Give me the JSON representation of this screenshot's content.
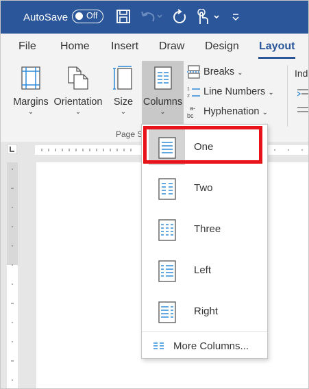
{
  "titlebar": {
    "autosave_label": "AutoSave",
    "toggle_state": "Off",
    "icons": [
      "save-icon",
      "undo-icon",
      "redo-icon",
      "touch-mode-icon",
      "customize-quick-access-icon"
    ],
    "color": "#2b579a"
  },
  "tabs": [
    {
      "label": "File",
      "active": false
    },
    {
      "label": "Home",
      "active": false
    },
    {
      "label": "Insert",
      "active": false
    },
    {
      "label": "Draw",
      "active": false
    },
    {
      "label": "Design",
      "active": false
    },
    {
      "label": "Layout",
      "active": true
    }
  ],
  "ribbon": {
    "margins": "Margins",
    "orientation": "Orientation",
    "size": "Size",
    "columns": "Columns",
    "breaks": "Breaks",
    "line_numbers": "Line Numbers",
    "hyphenation": "Hyphenation",
    "group_label": "Page S",
    "indent_label": "Ind"
  },
  "columns_menu": {
    "items": [
      {
        "label": "One",
        "selected": true
      },
      {
        "label": "Two",
        "selected": false
      },
      {
        "label": "Three",
        "selected": false
      },
      {
        "label": "Left",
        "selected": false
      },
      {
        "label": "Right",
        "selected": false
      }
    ],
    "more": "More Columns...",
    "highlight_color": "#e8121a"
  }
}
